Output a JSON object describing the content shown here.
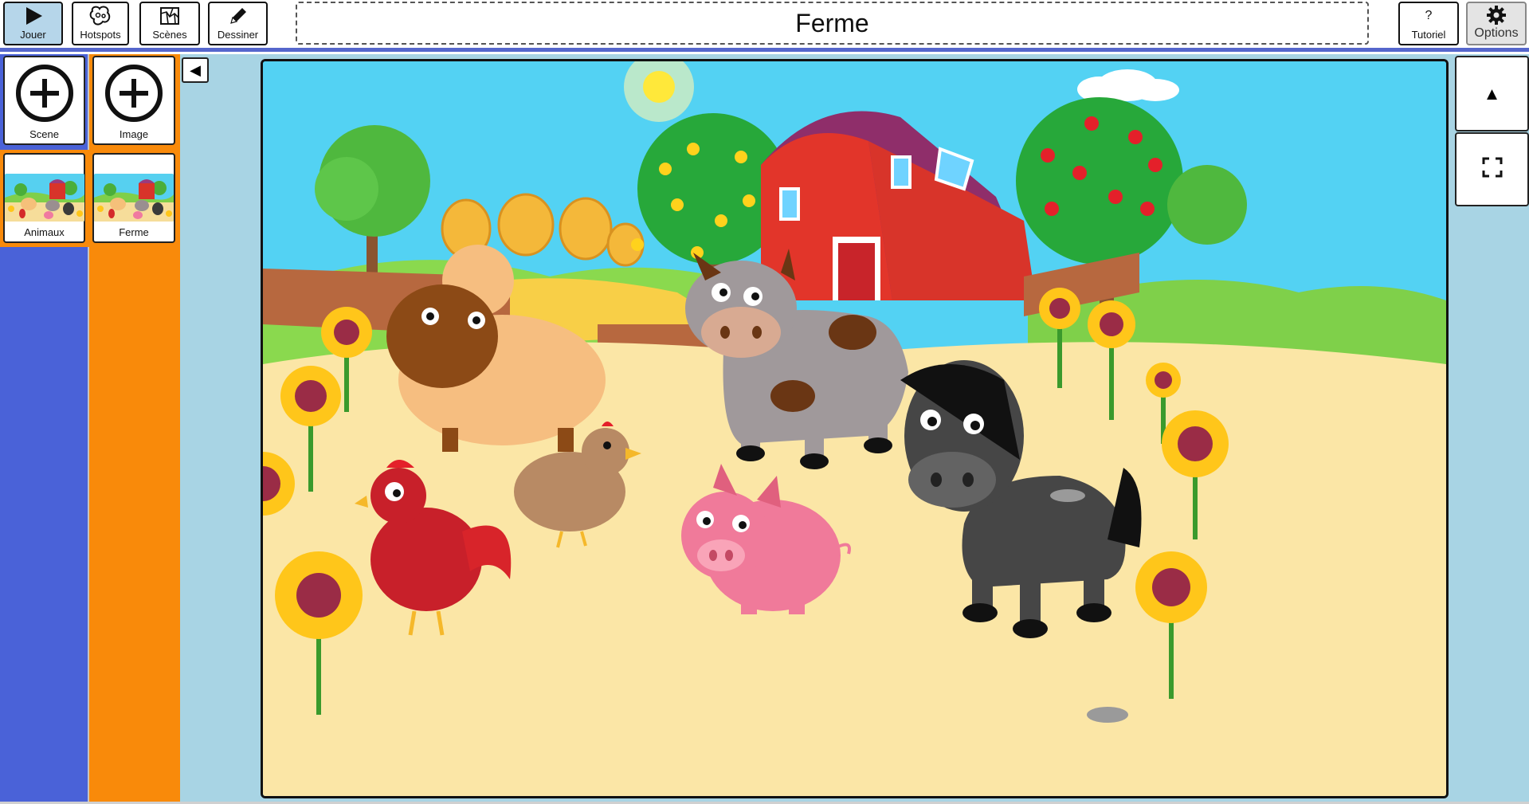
{
  "toolbar": {
    "play_label": "Jouer",
    "hotspots_label": "Hotspots",
    "scenes_label": "Scènes",
    "draw_label": "Dessiner",
    "tutorial_symbol": "?",
    "tutorial_label": "Tutoriel",
    "options_label": "Options"
  },
  "scene_title": "Ferme",
  "sidebar": {
    "add_scene_label": "Scene",
    "add_image_label": "Image",
    "scenes": [
      {
        "label": "Animaux"
      }
    ],
    "images": [
      {
        "label": "Ferme"
      }
    ]
  },
  "right_panel": {
    "up_symbol": "▲",
    "fullscreen_icon": "fullscreen-icon"
  },
  "collapse_symbol": "◀",
  "colors": {
    "accent": "#5566cc",
    "scenes_column": "#4a62d8",
    "images_column": "#f98a0a",
    "canvas_bg": "#a8d4e4",
    "active_button": "#b6d6ea"
  }
}
